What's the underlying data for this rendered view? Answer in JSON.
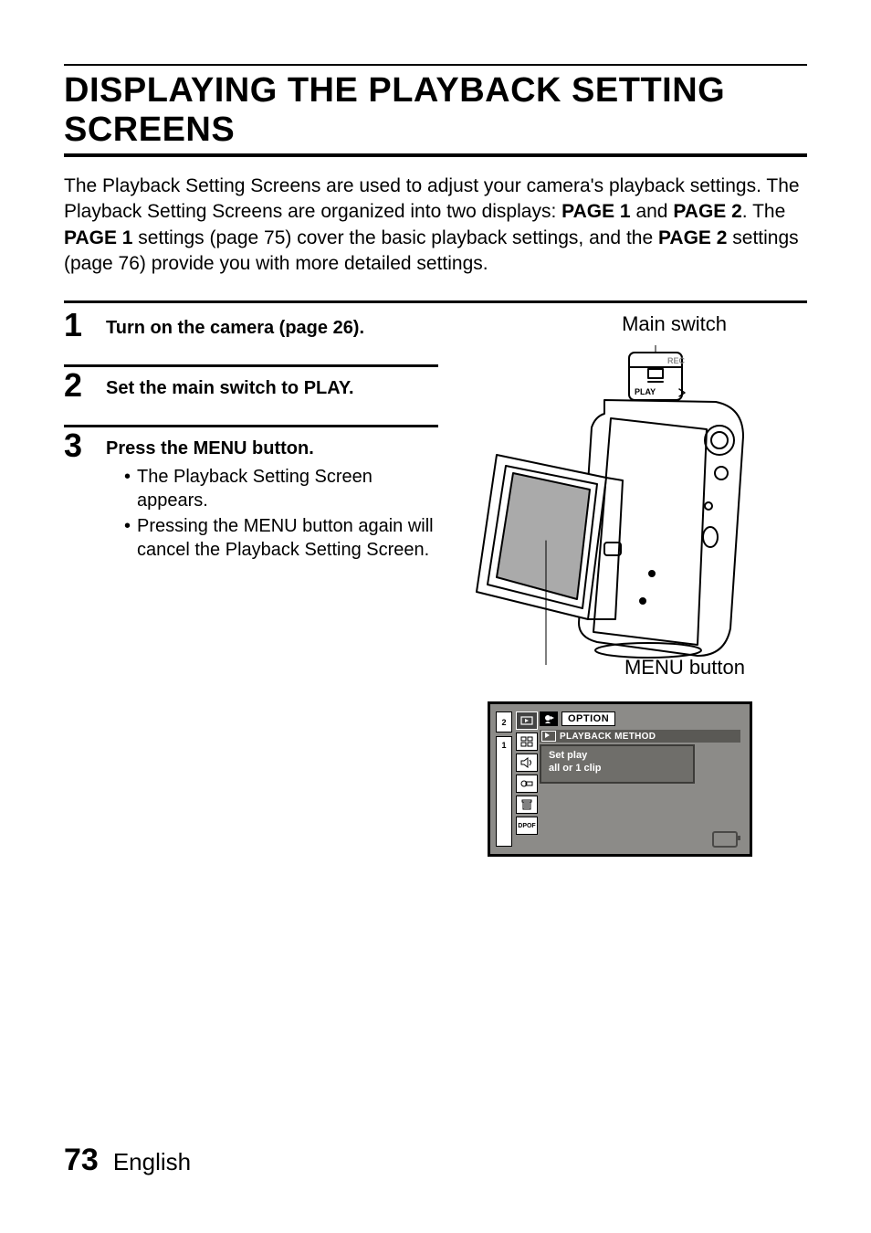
{
  "title": "DISPLAYING THE PLAYBACK SETTING SCREENS",
  "intro": {
    "t1": "The Playback Setting Screens are used to adjust your camera's playback settings. The Playback Setting Screens are organized into two displays: ",
    "b1": "PAGE 1",
    "t2": " and ",
    "b2": "PAGE 2",
    "t3": ". The ",
    "b3": "PAGE 1",
    "t4": " settings (page 75) cover the basic playback settings, and the ",
    "b4": "PAGE 2",
    "t5": " settings (page 76) provide you with more detailed settings."
  },
  "steps": [
    {
      "num": "1",
      "title": "Turn on the camera (page 26).",
      "bullets": []
    },
    {
      "num": "2",
      "title": "Set the main switch to PLAY.",
      "bullets": []
    },
    {
      "num": "3",
      "title": "Press the MENU button.",
      "bullets": [
        "The Playback Setting Screen appears.",
        "Pressing the MENU button again will cancel the Playback Setting Screen."
      ]
    }
  ],
  "labels": {
    "main_switch": "Main switch",
    "menu_button": "MENU button"
  },
  "switch": {
    "rec": "REC",
    "play": "PLAY"
  },
  "lcd": {
    "option": "OPTION",
    "playback_method": "PLAYBACK METHOD",
    "desc_l1": "Set play",
    "desc_l2": "all or 1 clip",
    "dpof": "DPOF",
    "tab1": "1",
    "tab2": "2"
  },
  "footer": {
    "page": "73",
    "lang": "English"
  }
}
